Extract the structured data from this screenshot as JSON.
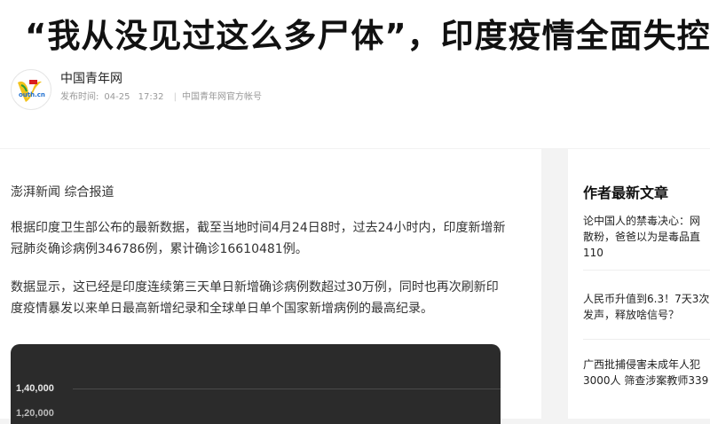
{
  "article": {
    "title": "“我从没见过这么多尸体”，印度疫情全面失控",
    "author": "中国青年网",
    "publish_label": "发布时间:",
    "publish_date": "04-25",
    "publish_time": "17:32",
    "account": "中国青年网官方帐号",
    "source_line": "澎湃新闻 综合报道",
    "paragraphs": [
      "根据印度卫生部公布的最新数据，截至当地时间4月24日8时，过去24小时内，印度新增新冠肺炎确诊病例346786例，累计确诊16610481例。",
      "数据显示，这已经是印度连续第三天单日新增确诊病例数超过30万例，同时也再次刷新印度疫情暴发以来单日最高新增纪录和全球单日单个国家新增病例的最高纪录。"
    ],
    "image_ticks": [
      "1,40,000",
      "1,20,000"
    ]
  },
  "avatar": {
    "logo_text": "outh.cn",
    "badge_text": "中国青年网"
  },
  "sidebar": {
    "heading": "作者最新文章",
    "items": [
      {
        "lines": [
          "论中国人的禁毒决心：网",
          "散粉，爸爸以为是毒品直",
          "110"
        ]
      },
      {
        "lines": [
          "人民币升值到6.3！7天3次",
          "发声，释放啥信号？"
        ]
      },
      {
        "lines": [
          "广西批捕侵害未成年人犯",
          "3000人 筛查涉案教师339"
        ]
      }
    ]
  },
  "colors": {
    "verified": "#3a8ee6",
    "page_bg": "#f3f3f3"
  }
}
